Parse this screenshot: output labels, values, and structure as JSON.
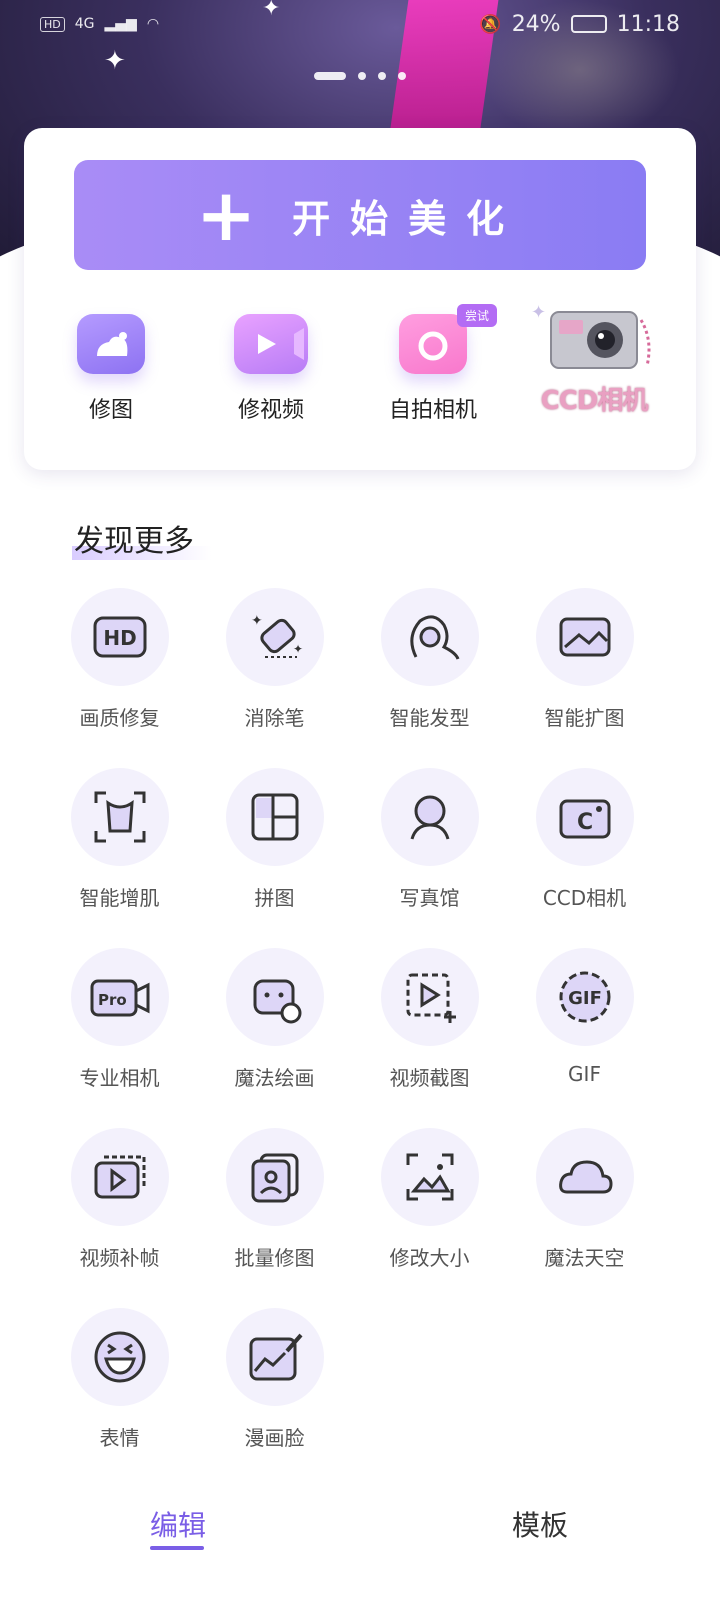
{
  "status_bar": {
    "left_badge": "HD",
    "signal": "4G",
    "battery": "24%",
    "time": "11:18"
  },
  "banner": {
    "pages": 4,
    "active_page": 1
  },
  "main_card": {
    "start_button": {
      "label": "开始美化"
    },
    "quick_actions": [
      {
        "label": "修图",
        "icon": "photo-icon"
      },
      {
        "label": "修视频",
        "icon": "video-icon"
      },
      {
        "label": "自拍相机",
        "icon": "camera-icon",
        "badge": "尝试"
      },
      {
        "label": "CCD相机",
        "icon": "ccd-camera-icon"
      }
    ]
  },
  "discover": {
    "title": "发现更多",
    "tools": [
      {
        "label": "画质修复",
        "icon": "hd-icon"
      },
      {
        "label": "消除笔",
        "icon": "eraser-icon"
      },
      {
        "label": "智能发型",
        "icon": "hairstyle-icon"
      },
      {
        "label": "智能扩图",
        "icon": "expand-image-icon"
      },
      {
        "label": "智能增肌",
        "icon": "muscle-icon"
      },
      {
        "label": "拼图",
        "icon": "collage-icon"
      },
      {
        "label": "写真馆",
        "icon": "portrait-studio-icon"
      },
      {
        "label": "CCD相机",
        "icon": "ccd-icon"
      },
      {
        "label": "专业相机",
        "icon": "pro-camera-icon"
      },
      {
        "label": "魔法绘画",
        "icon": "magic-painting-icon"
      },
      {
        "label": "视频截图",
        "icon": "video-screenshot-icon"
      },
      {
        "label": "GIF",
        "icon": "gif-icon"
      },
      {
        "label": "视频补帧",
        "icon": "video-frame-icon"
      },
      {
        "label": "批量修图",
        "icon": "batch-edit-icon"
      },
      {
        "label": "修改大小",
        "icon": "resize-icon"
      },
      {
        "label": "魔法天空",
        "icon": "cloud-icon"
      },
      {
        "label": "表情",
        "icon": "emoji-icon"
      },
      {
        "label": "漫画脸",
        "icon": "comic-face-icon"
      }
    ]
  },
  "bottom_nav": {
    "tabs": [
      {
        "label": "编辑",
        "active": true
      },
      {
        "label": "模板",
        "active": false
      }
    ]
  },
  "colors": {
    "accent": "#7a5ee6",
    "button_start": "#a98cf6",
    "button_end": "#8a7cf3",
    "tool_bg": "#f3f1fc"
  }
}
